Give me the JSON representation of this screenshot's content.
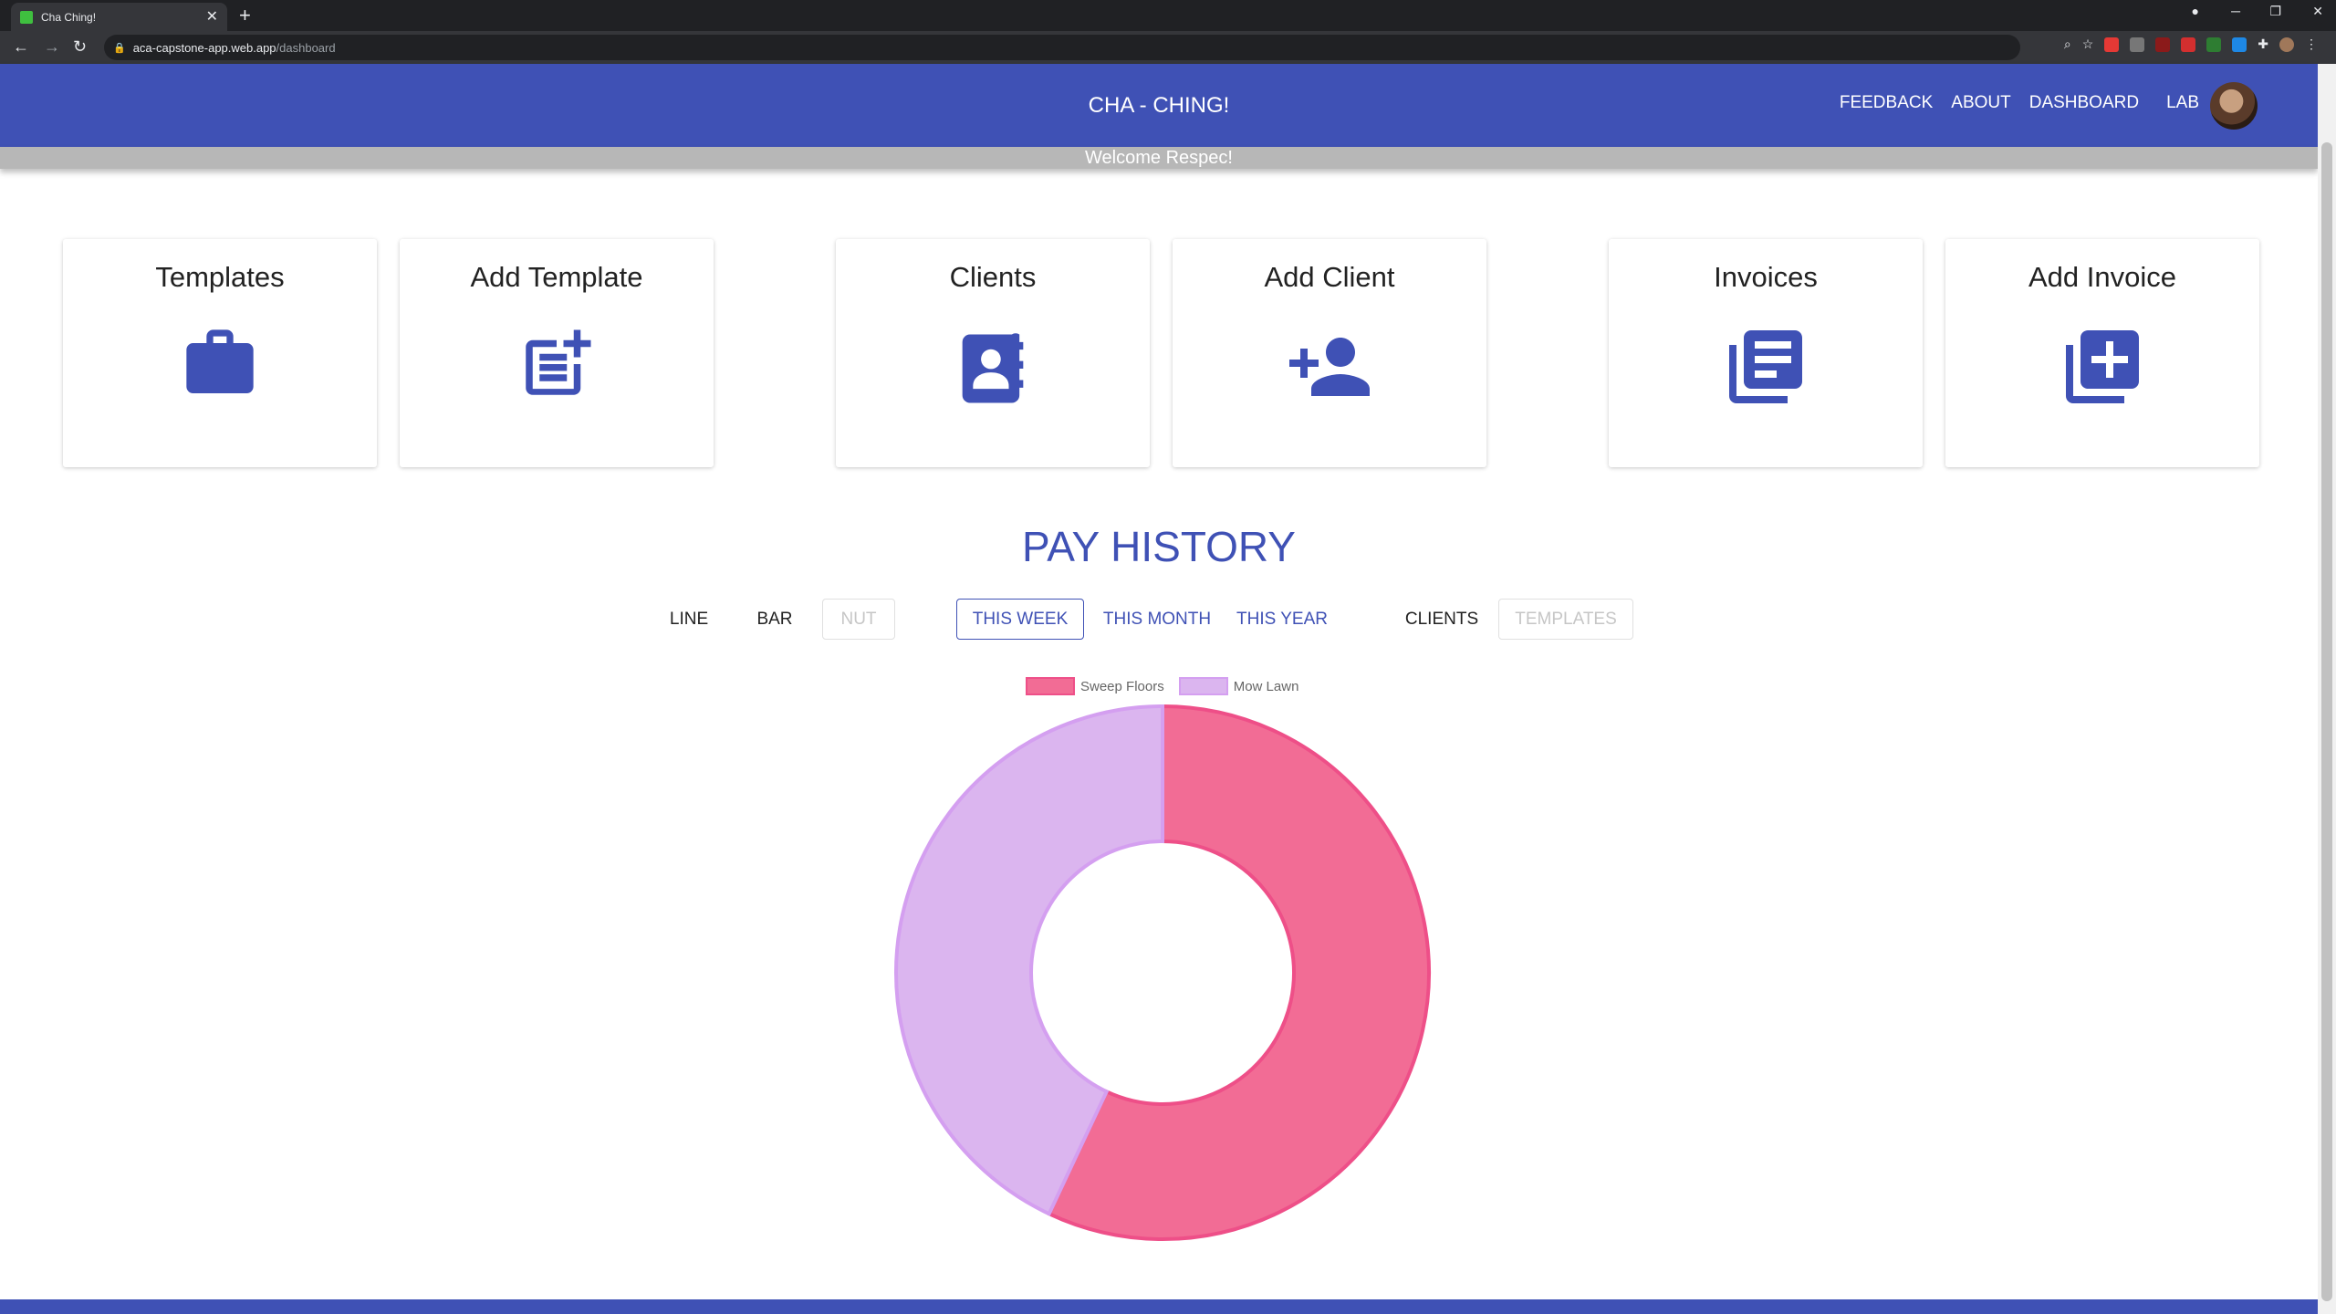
{
  "browser": {
    "tab_title": "Cha Ching!",
    "tab_close": "✕",
    "new_tab": "+",
    "url_host": "aca-capstone-app.web.app",
    "url_path": "/dashboard"
  },
  "header": {
    "brand": "CHA - CHING!",
    "nav": [
      "FEEDBACK",
      "ABOUT",
      "DASHBOARD",
      "LAB"
    ],
    "welcome": "Welcome Respec!"
  },
  "cards": [
    {
      "title": "Templates",
      "icon": "briefcase-icon"
    },
    {
      "title": "Add Template",
      "icon": "post-add-icon"
    },
    {
      "title": "Clients",
      "icon": "contacts-book-icon"
    },
    {
      "title": "Add Client",
      "icon": "person-add-icon"
    },
    {
      "title": "Invoices",
      "icon": "library-books-icon"
    },
    {
      "title": "Add Invoice",
      "icon": "library-add-icon"
    }
  ],
  "pay_history": {
    "title": "PAY HISTORY",
    "chart_types": [
      "LINE",
      "BAR",
      "NUT"
    ],
    "chart_type_selected": "NUT",
    "ranges": [
      "THIS WEEK",
      "THIS MONTH",
      "THIS YEAR"
    ],
    "range_selected": "THIS WEEK",
    "groupings": [
      "CLIENTS",
      "TEMPLATES"
    ],
    "grouping_selected": "TEMPLATES"
  },
  "colors": {
    "primary": "#3f51b5",
    "sweep_fill": "#f26c95",
    "sweep_border": "#ee4f88",
    "mow_fill": "#dbb5ef",
    "mow_border": "#d49ff0"
  },
  "chart_data": {
    "type": "pie",
    "variant": "doughnut",
    "labels": [
      "Sweep Floors",
      "Mow Lawn"
    ],
    "values": [
      57,
      43
    ],
    "legend": "top"
  }
}
